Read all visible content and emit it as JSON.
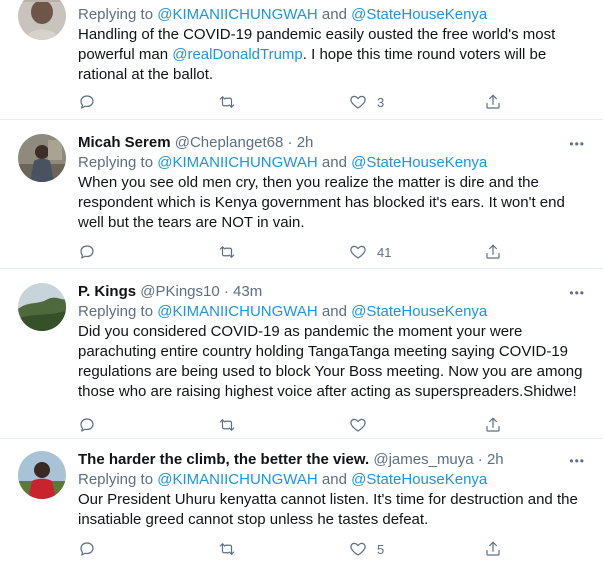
{
  "tweets": [
    {
      "reply_prefix": "Replying to ",
      "mention1": "@KIMANIICHUNGWAH",
      "and": " and ",
      "mention2": "@StateHouseKenya",
      "lines": [
        "Handling of the COVID-19 pandemic easily ousted the free world's most",
        "rational at the ballot."
      ],
      "line2_pre": "powerful man ",
      "line2_mention": "@realDonaldTrump",
      "line2_post": ". I hope this time round voters will be",
      "like_count": "3",
      "avatar_icon": "person-avatar"
    },
    {
      "name": "Micah Serem",
      "handle": "@Cheplanget68",
      "dot": " · ",
      "time": "2h",
      "reply_prefix": "Replying to ",
      "mention1": "@KIMANIICHUNGWAH",
      "and": " and ",
      "mention2": "@StateHouseKenya",
      "lines": [
        "When you see old men cry, then you realize the matter is dire and the",
        "respondent which is Kenya government has blocked it's ears. It won't end",
        "well but the tears are NOT in vain."
      ],
      "like_count": "41",
      "more": "•••"
    },
    {
      "name": "P. Kings",
      "handle": "@PKings10",
      "dot": " · ",
      "time": "43m",
      "reply_prefix": "Replying to ",
      "mention1": "@KIMANIICHUNGWAH",
      "and": " and ",
      "mention2": "@StateHouseKenya",
      "lines": [
        "Did you considered COVID-19 as pandemic the moment your were",
        "parachuting entire country holding TangaTanga meeting saying COVID-19",
        "regulations are being used to block Your Boss meeting. Now you are among",
        "those who are raising highest voice after acting as superspreaders.Shidwe!"
      ],
      "like_count": "",
      "more": "•••"
    },
    {
      "name": "The harder the climb, the better the view.",
      "handle": "@james_muya",
      "dot": " · ",
      "time": "2h",
      "reply_prefix": "Replying to ",
      "mention1": "@KIMANIICHUNGWAH",
      "and": " and ",
      "mention2": "@StateHouseKenya",
      "lines": [
        "Our President Uhuru kenyatta cannot listen. It's time for destruction and the",
        "insatiable greed cannot stop unless he tastes defeat."
      ],
      "like_count": "5",
      "more": "•••"
    }
  ],
  "colors": {
    "accent": "#1b95e0",
    "muted": "#5b7083",
    "divider": "#e6ecf0",
    "text": "#0f1419"
  },
  "icons": [
    "reply-icon",
    "retweet-icon",
    "like-icon",
    "share-icon",
    "more-icon"
  ]
}
